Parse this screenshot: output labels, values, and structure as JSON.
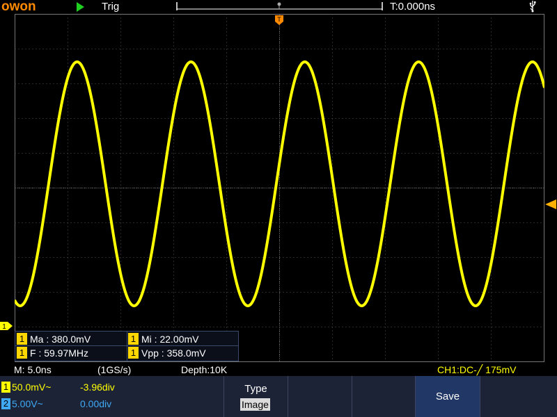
{
  "brand": {
    "logo": "owon"
  },
  "top_bar": {
    "run_state_icon": "play-icon",
    "trigger_status": "Trig",
    "time_position": "T:0.000ns",
    "usb_icon": "usb-icon"
  },
  "markers": {
    "trigger_position": "T",
    "channel1": "1"
  },
  "measurements": [
    {
      "channel": "1",
      "label": "Ma : 380.0mV"
    },
    {
      "channel": "1",
      "label": "Mi : 22.00mV"
    },
    {
      "channel": "1",
      "label": "F : 59.97MHz"
    },
    {
      "channel": "1",
      "label": "Vpp : 358.0mV"
    }
  ],
  "status": {
    "timebase": "M: 5.0ns",
    "sample_rate": "(1GS/s)",
    "depth": "Depth:10K",
    "trigger_info": "CH1:DC-╱ 175mV"
  },
  "channels": [
    {
      "number": "1",
      "scale": "50.0mV~",
      "offset": "-3.96div",
      "color": "#ffff00"
    },
    {
      "number": "2",
      "scale": "5.00V~",
      "offset": "0.00div",
      "color": "#3fa9f5"
    }
  ],
  "menu": {
    "type_title": "Type",
    "type_value": "Image",
    "save_label": "Save"
  },
  "colors": {
    "ch1": "#ffff00",
    "ch2": "#3fa9f5",
    "brand": "#ff8a00",
    "menu_bg": "#1c2336",
    "active_button": "#213766"
  },
  "waveform": {
    "channel": "1",
    "shape": "sine",
    "frequency_mhz": 59.97,
    "max_mv": 380.0,
    "min_mv": 22.0,
    "vpp_mv": 358.0
  }
}
